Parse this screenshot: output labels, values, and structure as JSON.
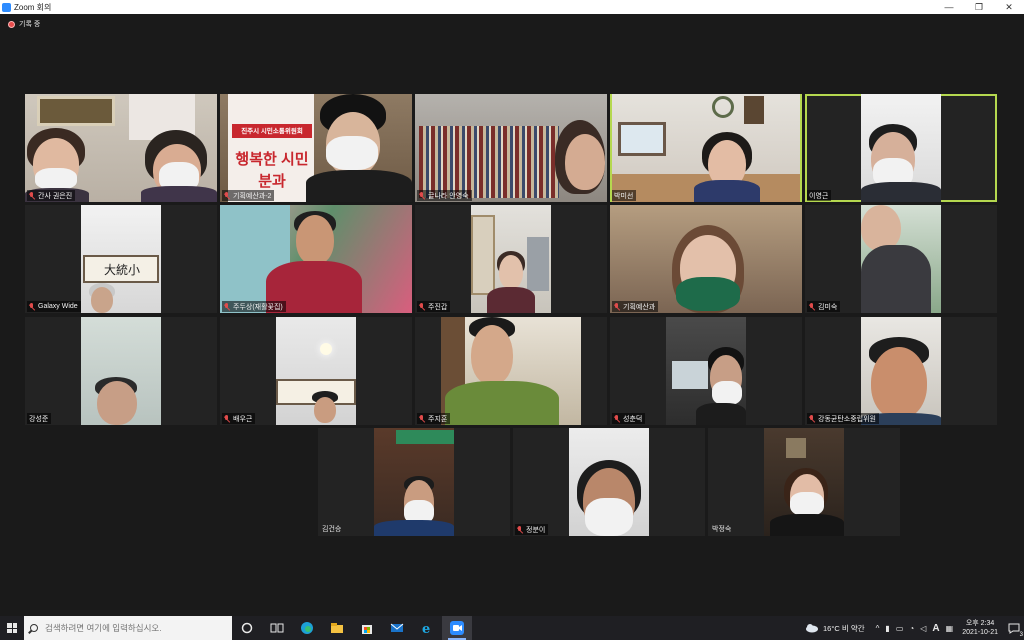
{
  "window": {
    "title": "Zoom 회의",
    "min_label": "—",
    "max_label": "❐",
    "close_label": "✕"
  },
  "recording": {
    "label": "기록 중"
  },
  "participants": [
    {
      "name": "간사 권은진",
      "muted": true
    },
    {
      "name": "기획예산과-2",
      "muted": true
    },
    {
      "name": "글나라 안영숙",
      "muted": true
    },
    {
      "name": "박미선",
      "muted": false,
      "active_speaker": true
    },
    {
      "name": "이영근",
      "muted": false
    },
    {
      "name": "Galaxy Wide",
      "muted": true
    },
    {
      "name": "주두상(재활꽃집)",
      "muted": true
    },
    {
      "name": "주진갑",
      "muted": true
    },
    {
      "name": "기획예산과",
      "muted": true
    },
    {
      "name": "김미숙",
      "muted": true
    },
    {
      "name": "강성준",
      "muted": false
    },
    {
      "name": "배우근",
      "muted": true
    },
    {
      "name": "주지훈",
      "muted": true
    },
    {
      "name": "성춘덕",
      "muted": true
    },
    {
      "name": "강동균탄소중립위원",
      "muted": true
    },
    {
      "name": "김건승",
      "muted": false
    },
    {
      "name": "정분이",
      "muted": true
    },
    {
      "name": "박정숙",
      "muted": false
    }
  ],
  "banner": {
    "line1": "진주시 시민소통위원회",
    "line2": "행복한 시민",
    "line3": "분과"
  },
  "sign_text": "大統小",
  "taskbar": {
    "search_placeholder": "검색하려면 여기에 입력하십시오.",
    "weather": "16°C  비 약간",
    "ime_label": "A",
    "time": "오후 2:34",
    "date": "2021-10-21",
    "notification_count": "3"
  },
  "colors": {
    "active_speaker_border": "#b5d84f",
    "muted_mic": "#e04b4b",
    "zoom_blue": "#2d8cff"
  }
}
